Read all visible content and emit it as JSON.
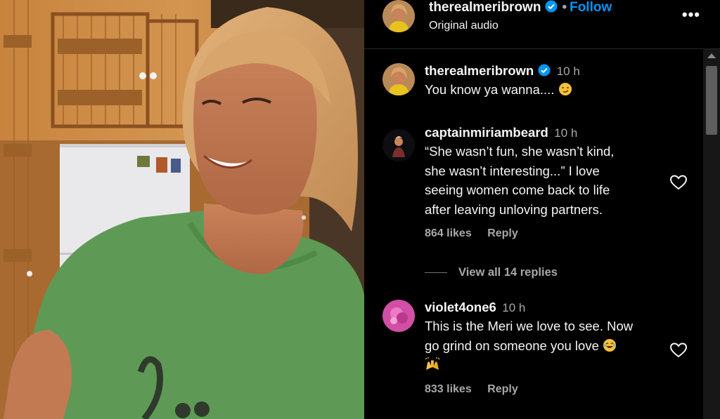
{
  "header": {
    "username": "therealmeribrown",
    "separator": "•",
    "follow_label": "Follow",
    "subtitle": "Original audio",
    "more_icon": "•••"
  },
  "comments": [
    {
      "username": "therealmeribrown",
      "verified": true,
      "time": "10 h",
      "text": "You know ya wanna....",
      "emoji": "smirk-emoji"
    },
    {
      "username": "captainmiriambeard",
      "time": "10 h",
      "lines": [
        "“She wasn’t fun, she wasn’t kind,",
        "she wasn’t interesting...” I love",
        "seeing women come back to life",
        "after leaving unloving partners."
      ],
      "likes": "864 likes",
      "reply_label": "Reply",
      "view_replies": "View all 14 replies"
    },
    {
      "username": "violet4one6",
      "time": "10 h",
      "lines": [
        "This is the Meri we love to see. Now",
        "go grind on someone you love"
      ],
      "emojis": [
        "laughing-emoji",
        "raised-hands-emoji"
      ],
      "likes": "833 likes",
      "reply_label": "Reply"
    }
  ],
  "colors": {
    "background": "#000000",
    "text": "#f5f5f5",
    "secondary": "#a8a8a8",
    "accent": "#0095f6"
  }
}
